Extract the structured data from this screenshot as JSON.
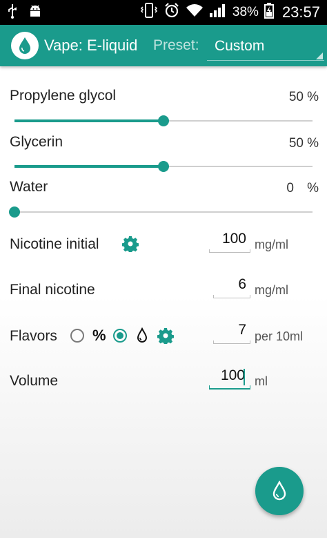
{
  "statusbar": {
    "battery": "38%",
    "time": "23:57"
  },
  "appbar": {
    "title": "Vape: E-liquid",
    "preset_label": "Preset:",
    "preset_value": "Custom"
  },
  "sliders": [
    {
      "label": "Propylene glycol",
      "value_text": "50",
      "unit": "%",
      "percent": 50
    },
    {
      "label": "Glycerin",
      "value_text": "50",
      "unit": "%",
      "percent": 50
    },
    {
      "label": "Water",
      "value_text": "0",
      "unit": "%",
      "percent": 0
    }
  ],
  "nicotine_initial": {
    "label": "Nicotine initial",
    "value": "100",
    "unit": "mg/ml"
  },
  "final_nicotine": {
    "label": "Final nicotine",
    "value": "6",
    "unit": "mg/ml"
  },
  "flavors": {
    "label": "Flavors",
    "percent_symbol": "%",
    "selected": "drops",
    "value": "7",
    "unit": "per 10ml"
  },
  "volume": {
    "label": "Volume",
    "value": "100",
    "unit": "ml"
  },
  "colors": {
    "accent": "#1a9b8c"
  }
}
